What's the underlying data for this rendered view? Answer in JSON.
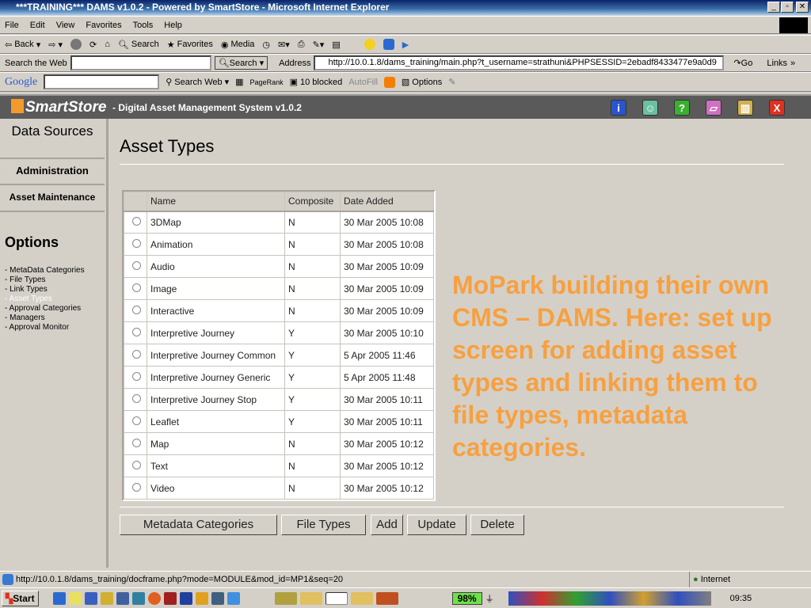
{
  "window": {
    "title": "***TRAINING*** DAMS v1.0.2 - Powered by SmartStore - Microsoft Internet Explorer"
  },
  "menu": [
    "File",
    "Edit",
    "View",
    "Favorites",
    "Tools",
    "Help"
  ],
  "toolbar": {
    "back": "Back",
    "search": "Search",
    "favorites": "Favorites",
    "media": "Media"
  },
  "searchbar": {
    "label": "Search the Web",
    "button": "Search",
    "address_label": "Address",
    "url": "http://10.0.1.8/dams_training/main.php?t_username=strathuni&PHPSESSID=2ebadf8433477e9a0d9",
    "go": "Go",
    "links": "Links"
  },
  "googlebar": {
    "logo": "Google",
    "search_web": "Search Web",
    "pagerank": "PageRank",
    "blocked": "10 blocked",
    "autofill": "AutoFill",
    "options": "Options"
  },
  "app": {
    "logo": "SmartStore",
    "title": "- Digital Asset Management System v1.0.2"
  },
  "sidebar": {
    "data_sources": "Data Sources",
    "administration": "Administration",
    "asset_maintenance": "Asset Maintenance",
    "options_heading": "Options",
    "options": [
      "- MetaData Categories",
      "- File Types",
      "- Link Types",
      "- Asset Types",
      "- Approval Categories",
      "- Managers",
      "- Approval Monitor"
    ]
  },
  "main": {
    "title": "Asset Types",
    "columns": [
      "Name",
      "Composite",
      "Date Added"
    ],
    "rows": [
      [
        "3DMap",
        "N",
        "30 Mar 2005 10:08"
      ],
      [
        "Animation",
        "N",
        "30 Mar 2005 10:08"
      ],
      [
        "Audio",
        "N",
        "30 Mar 2005 10:09"
      ],
      [
        "Image",
        "N",
        "30 Mar 2005 10:09"
      ],
      [
        "Interactive",
        "N",
        "30 Mar 2005 10:09"
      ],
      [
        "Interpretive Journey",
        "Y",
        "30 Mar 2005 10:10"
      ],
      [
        "Interpretive Journey Common",
        "Y",
        "5 Apr 2005 11:46"
      ],
      [
        "Interpretive Journey Generic",
        "Y",
        "5 Apr 2005 11:48"
      ],
      [
        "Interpretive Journey Stop",
        "Y",
        "30 Mar 2005 10:11"
      ],
      [
        "Leaflet",
        "Y",
        "30 Mar 2005 10:11"
      ],
      [
        "Map",
        "N",
        "30 Mar 2005 10:12"
      ],
      [
        "Text",
        "N",
        "30 Mar 2005 10:12"
      ],
      [
        "Video",
        "N",
        "30 Mar 2005 10:12"
      ]
    ],
    "buttons": [
      "Metadata Categories",
      "File Types",
      "Add",
      "Update",
      "Delete"
    ]
  },
  "annotation": "MoPark building their own CMS – DAMS. Here: set up screen for adding asset types and linking them to file types, metadata categories.",
  "status": {
    "url": "http://10.0.1.8/dams_training/docframe.php?mode=MODULE&mod_id=MP1&seq=20",
    "zone": "Internet"
  },
  "taskbar": {
    "start": "Start",
    "battery": "98%",
    "clock": "09:35"
  }
}
